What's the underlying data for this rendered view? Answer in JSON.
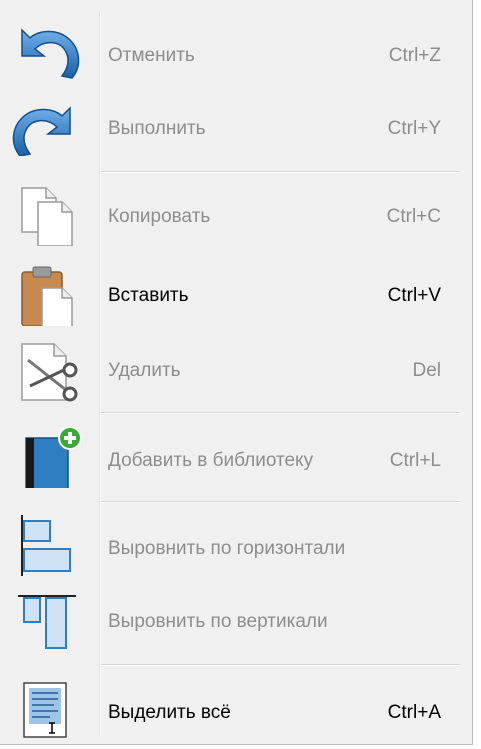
{
  "menu": {
    "items": [
      {
        "label": "Отменить",
        "shortcut": "Ctrl+Z",
        "icon": "undo-icon",
        "enabled": false
      },
      {
        "label": "Выполнить",
        "shortcut": "Ctrl+Y",
        "icon": "redo-icon",
        "enabled": false
      },
      {
        "label": "Копировать",
        "shortcut": "Ctrl+C",
        "icon": "copy-icon",
        "enabled": false
      },
      {
        "label": "Вставить",
        "shortcut": "Ctrl+V",
        "icon": "paste-icon",
        "enabled": true
      },
      {
        "label": "Удалить",
        "shortcut": "Del",
        "icon": "cut-scissors-icon",
        "enabled": false
      },
      {
        "label": "Добавить в библиотеку",
        "shortcut": "Ctrl+L",
        "icon": "add-to-library-icon",
        "enabled": false
      },
      {
        "label": "Выровнить по горизонтали",
        "shortcut": "",
        "icon": "align-horizontal-icon",
        "enabled": false
      },
      {
        "label": "Выровнить по вертикали",
        "shortcut": "",
        "icon": "align-vertical-icon",
        "enabled": false
      },
      {
        "label": "Выделить всё",
        "shortcut": "Ctrl+A",
        "icon": "select-all-icon",
        "enabled": true
      }
    ]
  },
  "colors": {
    "background": "#f0f0f0",
    "text_enabled": "#000000",
    "text_disabled": "#8d8d8d",
    "icon_blue": "#2f7ec1",
    "add_green": "#3aa935"
  }
}
